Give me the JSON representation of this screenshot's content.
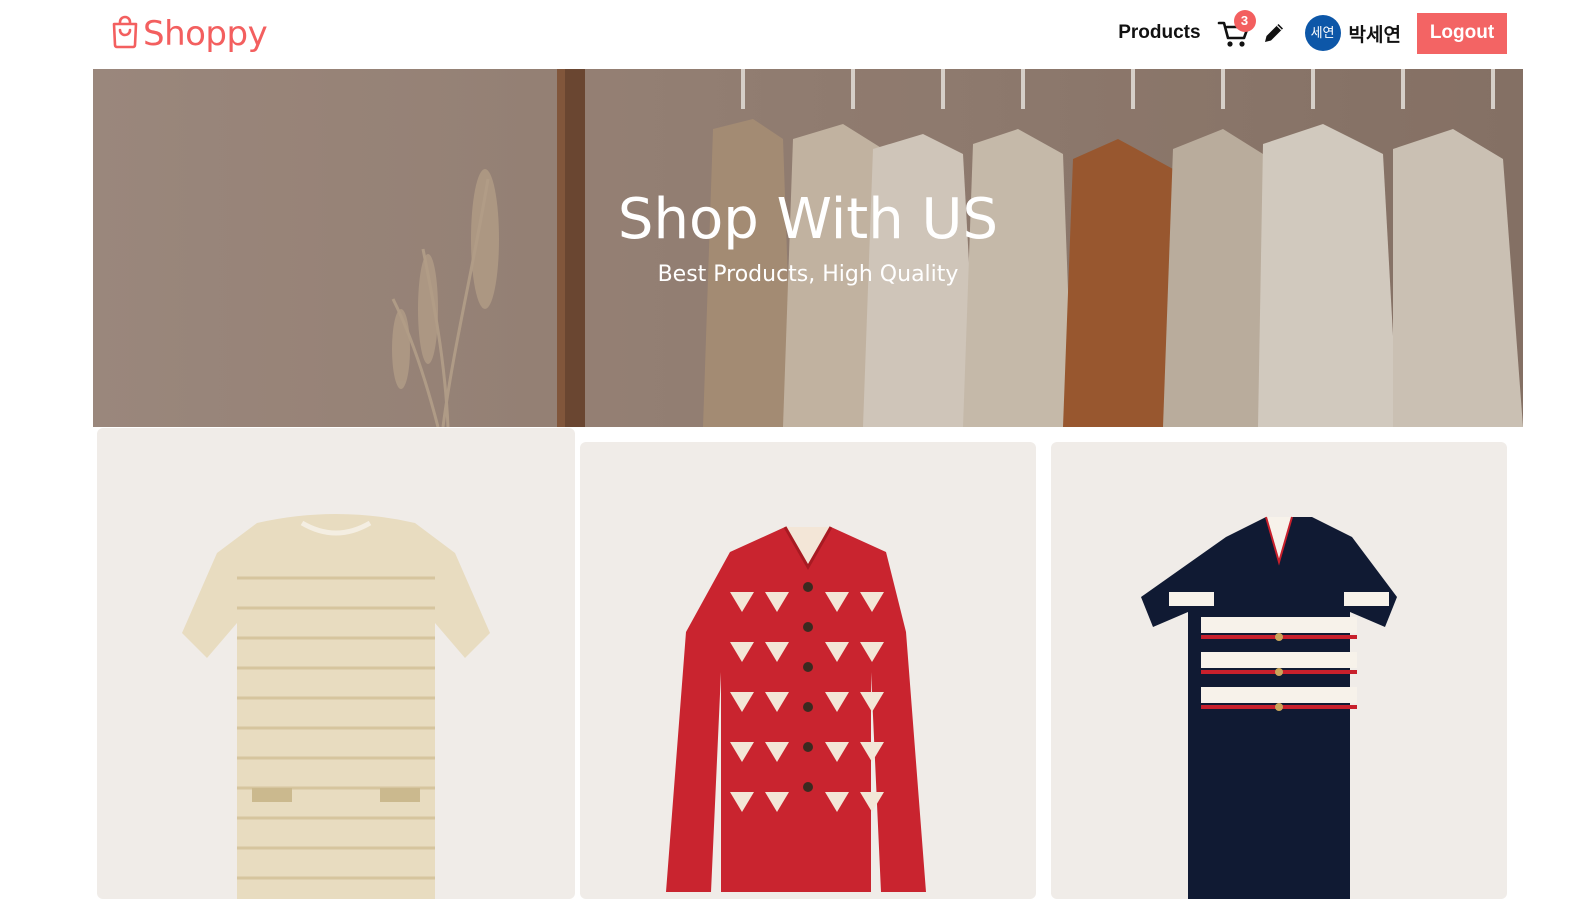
{
  "header": {
    "logo_text": "Shoppy",
    "nav_products": "Products",
    "cart_count": "3",
    "avatar_text": "세연",
    "username": "박세연",
    "logout_label": "Logout"
  },
  "hero": {
    "title": "Shop With US",
    "subtitle": "Best Products, High Quality"
  },
  "products": [
    {
      "icon": "tweed-dress-image"
    },
    {
      "icon": "red-pattern-jacket-image"
    },
    {
      "icon": "striped-polo-dress-image"
    }
  ],
  "colors": {
    "brand": "#f35f5f",
    "avatar": "#0d57a8",
    "card_bg": "#f0ece8"
  }
}
